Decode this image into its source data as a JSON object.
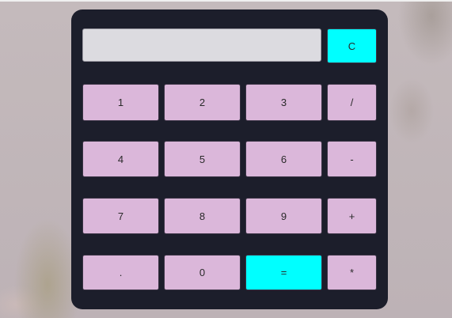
{
  "display": {
    "value": ""
  },
  "buttons": {
    "clear": "C",
    "row1": [
      "1",
      "2",
      "3",
      "/"
    ],
    "row2": [
      "4",
      "5",
      "6",
      "-"
    ],
    "row3": [
      "7",
      "8",
      "9",
      "+"
    ],
    "row4": [
      ".",
      "0",
      "=",
      "*"
    ]
  },
  "colors": {
    "panel": "#1c1e2b",
    "key": "#dbb7da",
    "accent": "#00ffff",
    "display": "#dcdbe0"
  }
}
